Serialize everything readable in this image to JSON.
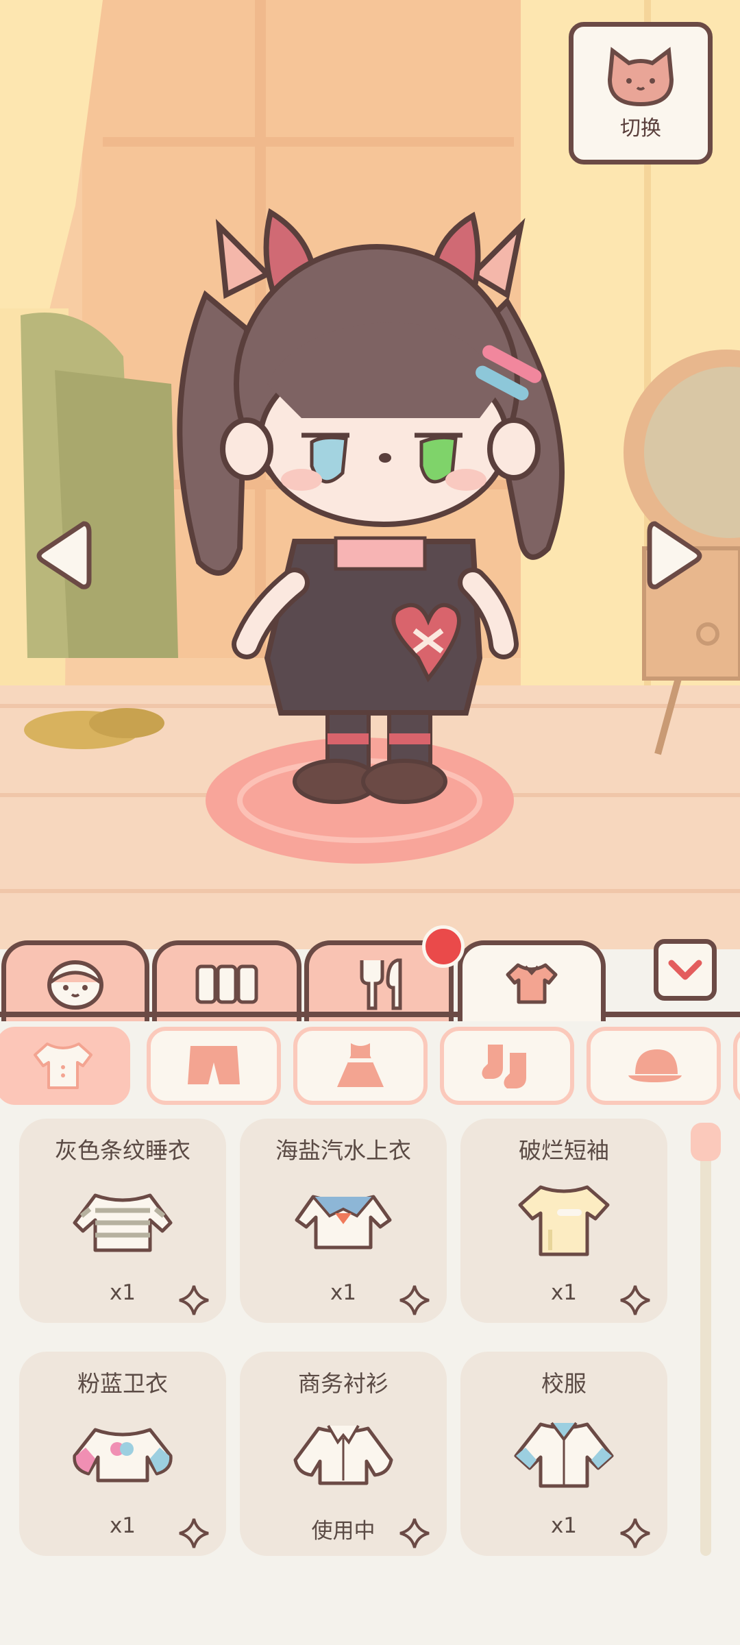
{
  "scene": {
    "switch_button_label": "切换",
    "character": "character-avatar"
  },
  "category_tabs": [
    {
      "id": "face",
      "icon": "face-icon",
      "active": false
    },
    {
      "id": "furniture",
      "icon": "furniture-icon",
      "active": false
    },
    {
      "id": "food",
      "icon": "fork-spoon-icon",
      "active": false,
      "notification": true
    },
    {
      "id": "clothing",
      "icon": "shirt-icon",
      "active": true
    }
  ],
  "subcategories": [
    {
      "icon": "top-shirt-icon",
      "active": true
    },
    {
      "icon": "shorts-icon",
      "active": false
    },
    {
      "icon": "dress-icon",
      "active": false
    },
    {
      "icon": "socks-icon",
      "active": false
    },
    {
      "icon": "hat-icon",
      "active": false
    }
  ],
  "items": [
    {
      "name": "灰色条纹睡衣",
      "status": "x1"
    },
    {
      "name": "海盐汽水上衣",
      "status": "x1"
    },
    {
      "name": "破烂短袖",
      "status": "x1"
    },
    {
      "name": "粉蓝卫衣",
      "status": "x1"
    },
    {
      "name": "商务衬衫",
      "status": "使用中"
    },
    {
      "name": "校服",
      "status": "x1"
    }
  ],
  "colors": {
    "outline": "#6b4a45",
    "accent_pink": "#f9c3b3",
    "panel": "#f4f2ec",
    "card": "#efe6dc",
    "notification": "#ea4a4a"
  }
}
